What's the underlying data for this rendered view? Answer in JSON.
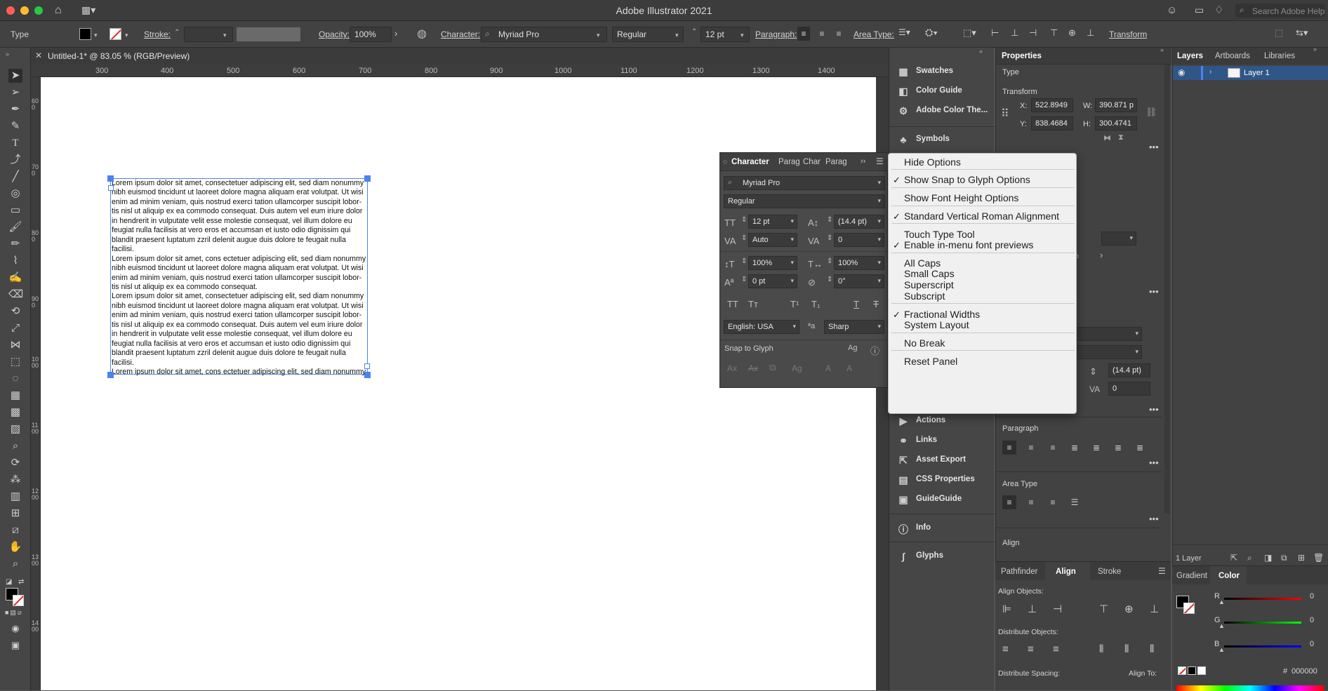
{
  "app": {
    "title": "Adobe Illustrator 2021",
    "search_placeholder": "Search Adobe Help"
  },
  "control_bar": {
    "mode": "Type",
    "stroke_label": "Stroke:",
    "opacity_label": "Opacity:",
    "opacity": "100%",
    "character_label": "Character:",
    "font": "Myriad Pro",
    "style": "Regular",
    "size": "12 pt",
    "paragraph_label": "Paragraph:",
    "area_type_label": "Area Type:",
    "transform_label": "Transform"
  },
  "document": {
    "tab_title": "Untitled-1* @ 83.05 % (RGB/Preview)"
  },
  "ruler": {
    "h": [
      "300",
      "400",
      "500",
      "600",
      "700",
      "800",
      "900",
      "1000",
      "1100",
      "1200",
      "1300",
      "1400"
    ],
    "v": [
      "600",
      "700",
      "800",
      "900",
      "1000",
      "1100",
      "1200",
      "1300",
      "1400"
    ]
  },
  "text_lines": [
    "Lorem ipsum dolor sit amet, consectetuer adipiscing elit, sed diam nonummy",
    "nibh euismod tincidunt ut laoreet dolore magna aliquam erat volutpat. Ut wisi",
    "enim ad minim veniam, quis nostrud exerci tation ullamcorper suscipit lobor-",
    "tis nisl ut aliquip ex ea commodo consequat. Duis autem vel eum iriure dolor",
    "in hendrerit in vulputate velit esse molestie consequat, vel illum dolore eu",
    "feugiat nulla facilisis at vero eros et accumsan et iusto odio dignissim qui",
    "blandit praesent luptatum zzril delenit augue duis dolore te feugait nulla",
    "facilisi.",
    "Lorem ipsum dolor sit amet, cons ectetuer adipiscing elit, sed diam nonummy",
    "nibh euismod tincidunt ut laoreet dolore magna aliquam erat volutpat. Ut wisi",
    "enim ad minim veniam, quis nostrud exerci tation ullamcorper suscipit lobor-",
    "tis nisl ut aliquip ex ea commodo consequat.",
    "Lorem ipsum dolor sit amet, consectetuer adipiscing elit, sed diam nonummy",
    "nibh euismod tincidunt ut laoreet dolore magna aliquam erat volutpat. Ut wisi",
    "enim ad minim veniam, quis nostrud exerci tation ullamcorper suscipit lobor-",
    "tis nisl ut aliquip ex ea commodo consequat. Duis autem vel eum iriure dolor",
    "in hendrerit in vulputate velit esse molestie consequat, vel illum dolore eu",
    "feugiat nulla facilisis at vero eros et accumsan et iusto odio dignissim qui",
    "blandit praesent luptatum zzril delenit augue duis dolore te feugait nulla",
    "facilisi.",
    "Lorem ipsum dolor sit amet, cons ectetuer adipiscing elit, sed diam nonummy"
  ],
  "mid_panels": {
    "top": [
      "Swatches",
      "Color Guide",
      "Adobe Color The...",
      "Symbols"
    ],
    "bottom": [
      "Actions",
      "Links",
      "Asset Export",
      "CSS Properties",
      "GuideGuide",
      "Info",
      "Glyphs"
    ]
  },
  "character_panel": {
    "tabs": [
      "Character",
      "Parag",
      "Char",
      "Parag"
    ],
    "font": "Myriad Pro",
    "style": "Regular",
    "size": "12 pt",
    "leading": "(14.4 pt)",
    "kerning": "Auto",
    "tracking": "0",
    "vscale": "100%",
    "hscale": "100%",
    "baseline": "0 pt",
    "rotation": "0°",
    "language": "English: USA",
    "antialias": "Sharp",
    "snap_label": "Snap to Glyph"
  },
  "flyout_menu": [
    {
      "label": "Hide Options",
      "checked": false
    },
    {
      "label": "Show Snap to Glyph Options",
      "checked": true
    },
    {
      "label": "Show Font Height Options",
      "checked": false
    },
    {
      "label": "Standard Vertical Roman Alignment",
      "checked": true
    },
    {
      "label": "Touch Type Tool",
      "checked": false
    },
    {
      "label": "Enable in-menu font previews",
      "checked": true
    },
    {
      "label": "All Caps",
      "checked": false
    },
    {
      "label": "Small Caps",
      "checked": false
    },
    {
      "label": "Superscript",
      "checked": false
    },
    {
      "label": "Subscript",
      "checked": false
    },
    {
      "label": "Fractional Widths",
      "checked": true
    },
    {
      "label": "System Layout",
      "checked": false
    },
    {
      "label": "No Break",
      "checked": false
    },
    {
      "label": "Reset Panel",
      "checked": false
    }
  ],
  "properties": {
    "tab": "Properties",
    "type_label": "Type",
    "transform_label": "Transform",
    "x_label": "X:",
    "x": "522.8949",
    "y_label": "Y:",
    "y": "838.4684",
    "w_label": "W:",
    "w": "390.871 p",
    "h_label": "H:",
    "h": "300.4741",
    "leading": "(14.4 pt)",
    "tracking": "0",
    "paragraph_label": "Paragraph",
    "area_type_label": "Area Type",
    "align_label": "Align"
  },
  "layers": {
    "tabs": [
      "Layers",
      "Artboards",
      "Libraries"
    ],
    "layer_name": "Layer 1",
    "count": "1 Layer"
  },
  "align_panel": {
    "tabs": [
      "Pathfinder",
      "Align",
      "Stroke"
    ],
    "align_objects": "Align Objects:",
    "distribute_objects": "Distribute Objects:",
    "distribute_spacing": "Distribute Spacing:",
    "align_to": "Align To:"
  },
  "color_panel": {
    "tabs": [
      "Gradient",
      "Color"
    ],
    "r_label": "R",
    "g_label": "G",
    "b_label": "B",
    "r": "0",
    "g": "0",
    "b": "0",
    "hash": "#",
    "hex": "000000"
  },
  "colors": {
    "selection": "#4d83f0",
    "ui_bg": "#535353",
    "panel": "#424242"
  }
}
